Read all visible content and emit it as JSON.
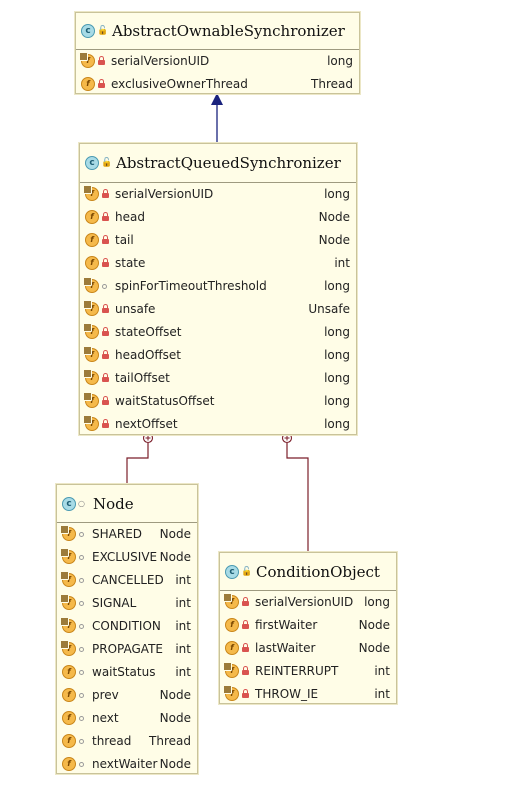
{
  "classes": {
    "aos": {
      "name": "AbstractOwnableSynchronizer",
      "fields": [
        {
          "name": "serialVersionUID",
          "type": "long"
        },
        {
          "name": "exclusiveOwnerThread",
          "type": "Thread"
        }
      ]
    },
    "aqs": {
      "name": "AbstractQueuedSynchronizer",
      "fields": [
        {
          "name": "serialVersionUID",
          "type": "long"
        },
        {
          "name": "head",
          "type": "Node"
        },
        {
          "name": "tail",
          "type": "Node"
        },
        {
          "name": "state",
          "type": "int"
        },
        {
          "name": "spinForTimeoutThreshold",
          "type": "long"
        },
        {
          "name": "unsafe",
          "type": "Unsafe"
        },
        {
          "name": "stateOffset",
          "type": "long"
        },
        {
          "name": "headOffset",
          "type": "long"
        },
        {
          "name": "tailOffset",
          "type": "long"
        },
        {
          "name": "waitStatusOffset",
          "type": "long"
        },
        {
          "name": "nextOffset",
          "type": "long"
        }
      ]
    },
    "node": {
      "name": "Node",
      "fields": [
        {
          "name": "SHARED",
          "type": "Node"
        },
        {
          "name": "EXCLUSIVE",
          "type": "Node"
        },
        {
          "name": "CANCELLED",
          "type": "int"
        },
        {
          "name": "SIGNAL",
          "type": "int"
        },
        {
          "name": "CONDITION",
          "type": "int"
        },
        {
          "name": "PROPAGATE",
          "type": "int"
        },
        {
          "name": "waitStatus",
          "type": "int"
        },
        {
          "name": "prev",
          "type": "Node"
        },
        {
          "name": "next",
          "type": "Node"
        },
        {
          "name": "thread",
          "type": "Thread"
        },
        {
          "name": "nextWaiter",
          "type": "Node"
        }
      ]
    },
    "cond": {
      "name": "ConditionObject",
      "fields": [
        {
          "name": "serialVersionUID",
          "type": "long"
        },
        {
          "name": "firstWaiter",
          "type": "Node"
        },
        {
          "name": "lastWaiter",
          "type": "Node"
        },
        {
          "name": "REINTERRUPT",
          "type": "int"
        },
        {
          "name": "THROW_IE",
          "type": "int"
        }
      ]
    }
  },
  "colors": {
    "inheritance_arrow": "#1a237e",
    "inner_class_link": "#7b1e2a",
    "class_bg": "#fffde7"
  }
}
